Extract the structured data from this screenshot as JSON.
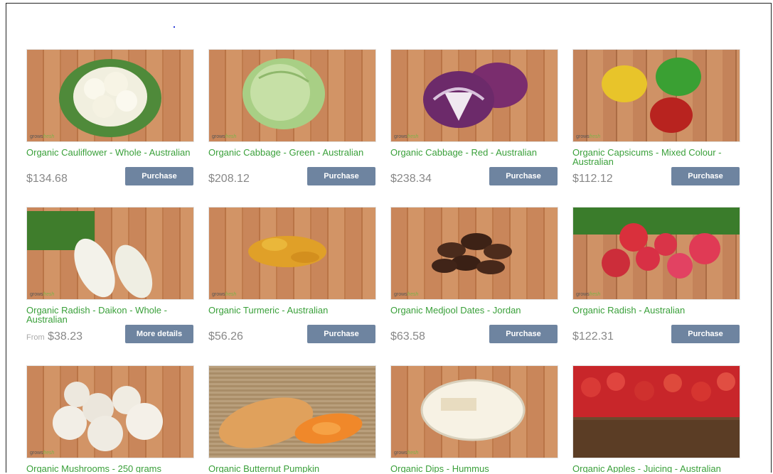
{
  "products": [
    {
      "title": "Organic Cauliflower - Whole - Australian",
      "price": "$134.68",
      "from": "",
      "button": "Purchase",
      "icon": "cauliflower-image"
    },
    {
      "title": "Organic Cabbage - Green - Australian",
      "price": "$208.12",
      "from": "",
      "button": "Purchase",
      "icon": "green-cabbage-image"
    },
    {
      "title": "Organic Cabbage - Red - Australian",
      "price": "$238.34",
      "from": "",
      "button": "Purchase",
      "icon": "red-cabbage-image"
    },
    {
      "title": "Organic Capsicums - Mixed Colour - Australian",
      "price": "$112.12",
      "from": "",
      "button": "Purchase",
      "icon": "capsicums-image"
    },
    {
      "title": "Organic Radish - Daikon - Whole - Australian",
      "price": "$38.23",
      "from": "From",
      "button": "More details",
      "icon": "daikon-image"
    },
    {
      "title": "Organic Turmeric - Australian",
      "price": "$56.26",
      "from": "",
      "button": "Purchase",
      "icon": "turmeric-image"
    },
    {
      "title": "Organic Medjool Dates - Jordan",
      "price": "$63.58",
      "from": "",
      "button": "Purchase",
      "icon": "dates-image"
    },
    {
      "title": "Organic Radish - Australian",
      "price": "$122.31",
      "from": "",
      "button": "Purchase",
      "icon": "radish-image"
    },
    {
      "title": "Organic Mushrooms - 250 grams",
      "icon": "mushrooms-image"
    },
    {
      "title": "Organic Butternut Pumpkin",
      "icon": "pumpkin-image"
    },
    {
      "title": "Organic Dips - Hummus",
      "icon": "hummus-image"
    },
    {
      "title": "Organic Apples - Juicing - Australian",
      "icon": "apples-image"
    }
  ],
  "watermark": {
    "a": "grows",
    "b": "fresh"
  }
}
